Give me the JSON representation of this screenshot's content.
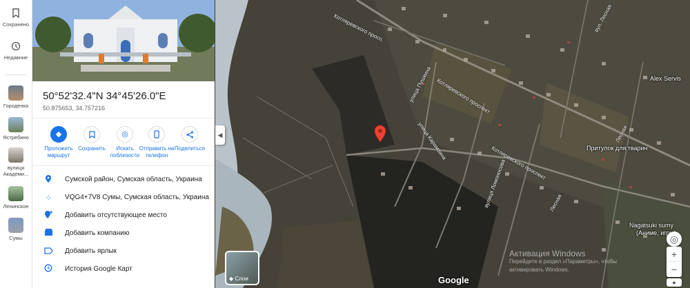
{
  "rail": {
    "saved": "Сохранено",
    "recent": "Недавние",
    "places": [
      {
        "label": "Городенка"
      },
      {
        "label": "Ястребино"
      },
      {
        "label": "вулиця Академи..."
      },
      {
        "label": "Ленинское"
      },
      {
        "label": "Сумы"
      }
    ]
  },
  "place": {
    "coords": "50°52'32.4\"N 34°45'26.0\"E",
    "decimal": "50.875653, 34.757216"
  },
  "actions": [
    {
      "label": "Проложить маршрут",
      "icon": "directions-icon"
    },
    {
      "label": "Сохранить",
      "icon": "bookmark-icon"
    },
    {
      "label": "Искать поблизости",
      "icon": "nearby-icon"
    },
    {
      "label": "Отправить на телефон",
      "icon": "phone-icon"
    },
    {
      "label": "Поделиться",
      "icon": "share-icon"
    }
  ],
  "details": [
    {
      "text": "Сумской район, Сумская область, Украина",
      "icon": "location-pin-icon"
    },
    {
      "text": "VQG4+7V8 Сумы, Сумская область, Украина",
      "icon": "plus-code-icon"
    },
    {
      "text": "Добавить отсутствующее место",
      "icon": "add-place-icon"
    },
    {
      "text": "Добавить компанию",
      "icon": "business-icon"
    },
    {
      "text": "Добавить ярлык",
      "icon": "label-icon"
    },
    {
      "text": "История Google Карт",
      "icon": "history-icon"
    }
  ],
  "map": {
    "streets": [
      {
        "text": "Котляревского просп."
      },
      {
        "text": "Котляревского проспект"
      },
      {
        "text": "Котляревского проспект"
      },
      {
        "text": "улица Пушкина"
      },
      {
        "text": "вул. Лесная"
      },
      {
        "text": "Лесная"
      },
      {
        "text": "улица Карамзина"
      },
      {
        "text": "вулиця Ломоносова"
      },
      {
        "text": "Лесная"
      }
    ],
    "pois": [
      {
        "text": "Alex Servis"
      },
      {
        "text": "Притулок для тварин"
      },
      {
        "text": "Nagatsuki sumy"
      },
      {
        "text": "(Аниме, игры)"
      }
    ],
    "layers_label": "Слои",
    "brand": "Google",
    "watermark_line1": "Активация Windows",
    "watermark_line2": "Перейдите в раздел «Параметры», чтобы",
    "watermark_line3": "активировать Windows."
  }
}
